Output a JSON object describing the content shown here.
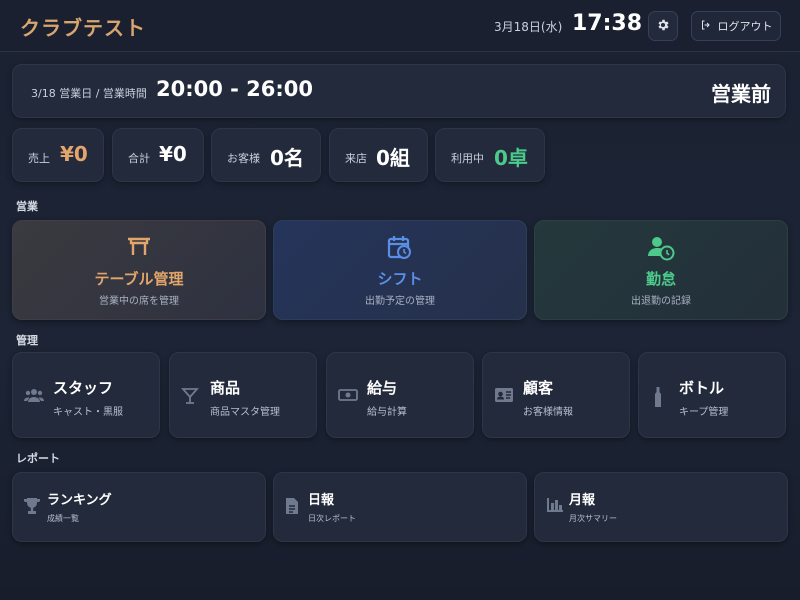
{
  "header": {
    "app_title": "クラブテスト",
    "date": "3月18日(水)",
    "time": "17:38",
    "settings_icon": "gear-icon",
    "logout_label": "ログアウト",
    "logout_icon": "logout-icon"
  },
  "business": {
    "label": "3/18 営業日 / 営業時間",
    "hours": "20:00 - 26:00",
    "status": "営業前"
  },
  "stats": [
    {
      "label": "売上",
      "value": "¥0",
      "color": "#e3a56b"
    },
    {
      "label": "合計",
      "value": "¥0",
      "color": "#ffffff"
    },
    {
      "label": "お客様",
      "value": "0名",
      "color": "#ffffff"
    },
    {
      "label": "来店",
      "value": "0組",
      "color": "#ffffff"
    },
    {
      "label": "利用中",
      "value": "0卓",
      "color": "#4cc98b"
    }
  ],
  "sections": {
    "operations": "営業",
    "management": "管理",
    "reports": "レポート"
  },
  "operations": [
    {
      "title": "テーブル管理",
      "sub": "営業中の席を管理",
      "icon": "table-icon",
      "color": "#e3a56b"
    },
    {
      "title": "シフト",
      "sub": "出勤予定の管理",
      "icon": "calendar-clock-icon",
      "color": "#5b8fe6"
    },
    {
      "title": "勤怠",
      "sub": "出退勤の記録",
      "icon": "person-clock-icon",
      "color": "#4cc98b"
    }
  ],
  "management": [
    {
      "title": "スタッフ",
      "sub": "キャスト・黒服",
      "icon": "people-icon"
    },
    {
      "title": "商品",
      "sub": "商品マスタ管理",
      "icon": "cocktail-icon"
    },
    {
      "title": "給与",
      "sub": "給与計算",
      "icon": "money-icon"
    },
    {
      "title": "顧客",
      "sub": "お客様情報",
      "icon": "id-card-icon"
    },
    {
      "title": "ボトル",
      "sub": "キープ管理",
      "icon": "bottle-icon"
    }
  ],
  "reports": [
    {
      "title": "ランキング",
      "sub": "成績一覧",
      "icon": "trophy-icon"
    },
    {
      "title": "日報",
      "sub": "日次レポート",
      "icon": "document-icon"
    },
    {
      "title": "月報",
      "sub": "月次サマリー",
      "icon": "bar-chart-icon"
    }
  ]
}
